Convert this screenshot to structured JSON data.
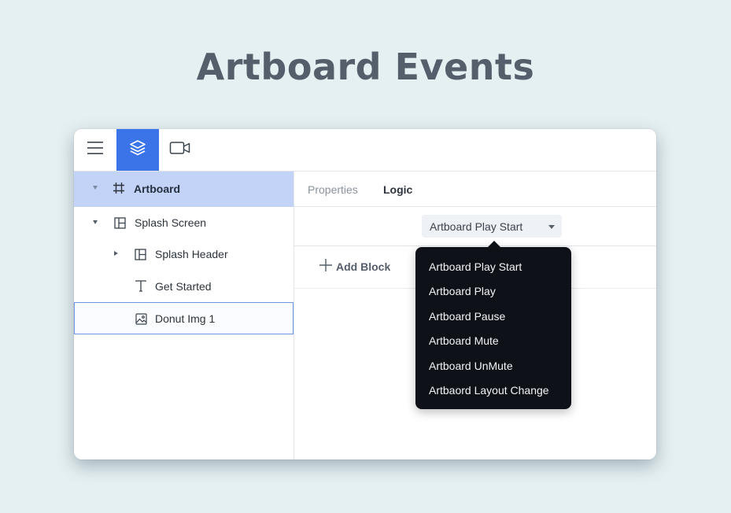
{
  "page": {
    "title": "Artboard Events"
  },
  "toolbar": {
    "buttons": [
      {
        "icon": "menu-icon"
      },
      {
        "icon": "layers-icon",
        "active": true
      },
      {
        "icon": "video-camera-icon"
      }
    ],
    "accent_color": "#3b74e8"
  },
  "layers": {
    "items": [
      {
        "label": "Artboard",
        "icon": "artboard-frame-icon",
        "selected": true
      },
      {
        "label": "Splash Screen",
        "icon": "layout-icon",
        "expanded": true
      },
      {
        "label": "Splash Header",
        "icon": "layout-icon",
        "expanded": false
      },
      {
        "label": "Get Started",
        "icon": "text-icon"
      },
      {
        "label": "Donut Img 1",
        "icon": "image-icon",
        "focused": true
      }
    ],
    "selected_color": "#c3d3f7"
  },
  "tabs": [
    {
      "label": "Properties",
      "active": false
    },
    {
      "label": "Logic",
      "active": true
    }
  ],
  "event_select": {
    "value": "Artboard Play Start"
  },
  "add_block": {
    "label": "Add Block"
  },
  "dropdown": {
    "options": [
      "Artboard Play Start",
      "Artboard Play",
      "Artboard Pause",
      "Artboard Mute",
      "Artboard UnMute",
      "Artbaord Layout Change"
    ]
  }
}
